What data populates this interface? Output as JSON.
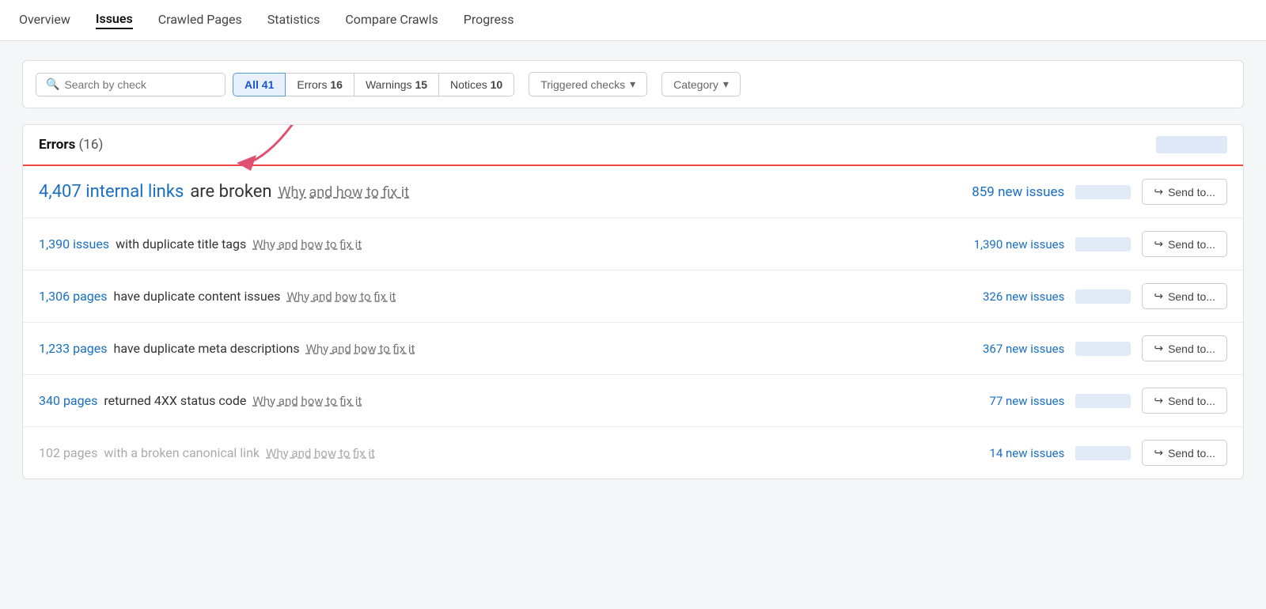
{
  "nav": {
    "items": [
      {
        "label": "Overview",
        "active": false
      },
      {
        "label": "Issues",
        "active": true
      },
      {
        "label": "Crawled Pages",
        "active": false
      },
      {
        "label": "Statistics",
        "active": false
      },
      {
        "label": "Compare Crawls",
        "active": false
      },
      {
        "label": "Progress",
        "active": false
      }
    ]
  },
  "filter": {
    "search_placeholder": "Search by check",
    "tabs": [
      {
        "label": "All",
        "count": "41",
        "active": true
      },
      {
        "label": "Errors",
        "count": "16",
        "active": false
      },
      {
        "label": "Warnings",
        "count": "15",
        "active": false
      },
      {
        "label": "Notices",
        "count": "10",
        "active": false
      }
    ],
    "triggered_label": "Triggered checks",
    "category_label": "Category"
  },
  "errors_section": {
    "title": "Errors",
    "count": "(16)"
  },
  "issues": [
    {
      "link_text": "4,407 internal links",
      "text": " are broken",
      "fix_text": "Why and how to fix it",
      "new_issues": "859 new issues",
      "send_label": "Send to...",
      "large": true,
      "dimmed": false
    },
    {
      "link_text": "1,390 issues",
      "text": " with duplicate title tags",
      "fix_text": "Why and how to fix it",
      "new_issues": "1,390 new issues",
      "send_label": "Send to...",
      "large": false,
      "dimmed": false
    },
    {
      "link_text": "1,306 pages",
      "text": " have duplicate content issues",
      "fix_text": "Why and how to fix it",
      "new_issues": "326 new issues",
      "send_label": "Send to...",
      "large": false,
      "dimmed": false
    },
    {
      "link_text": "1,233 pages",
      "text": " have duplicate meta descriptions",
      "fix_text": "Why and how to fix it",
      "new_issues": "367 new issues",
      "send_label": "Send to...",
      "large": false,
      "dimmed": false
    },
    {
      "link_text": "340 pages",
      "text": " returned 4XX status code",
      "fix_text": "Why and how to fix it",
      "new_issues": "77 new issues",
      "send_label": "Send to...",
      "large": false,
      "dimmed": false
    },
    {
      "link_text": "102 pages",
      "text": " with a broken canonical link",
      "fix_text": "Why and how to fix it",
      "new_issues": "14 new issues",
      "send_label": "Send to...",
      "large": false,
      "dimmed": true
    }
  ]
}
